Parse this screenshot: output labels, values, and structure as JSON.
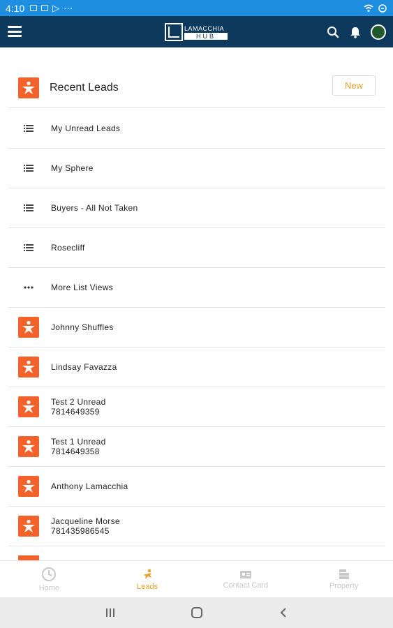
{
  "status_bar": {
    "time": "4:10",
    "more": "···"
  },
  "header": {
    "logo_name": "LAMACCHIA",
    "logo_sub": "HUB"
  },
  "list": {
    "title": "Recent Leads",
    "new_label": "New",
    "list_views": [
      {
        "label": "My Unread Leads",
        "icon": "list-icon"
      },
      {
        "label": "My Sphere",
        "icon": "list-icon"
      },
      {
        "label": "Buyers - All Not Taken",
        "icon": "list-icon"
      },
      {
        "label": "Rosecliff",
        "icon": "list-icon"
      },
      {
        "label": "More List Views",
        "icon": "more-icon"
      }
    ],
    "leads": [
      {
        "name": "Johnny Shuffles",
        "phone": ""
      },
      {
        "name": "Lindsay Favazza",
        "phone": ""
      },
      {
        "name": "Test 2 Unread",
        "phone": "7814649359"
      },
      {
        "name": "Test 1 Unread",
        "phone": "7814649358"
      },
      {
        "name": "Anthony Lamacchia",
        "phone": ""
      },
      {
        "name": "Jacqueline Morse",
        "phone": "781435986545"
      }
    ]
  },
  "bottom_nav": [
    {
      "label": "Home",
      "icon": "clock-icon",
      "active": false
    },
    {
      "label": "Leads",
      "icon": "leads-icon",
      "active": true
    },
    {
      "label": "Contact Card",
      "icon": "contact-card-icon",
      "active": false
    },
    {
      "label": "Property",
      "icon": "property-icon",
      "active": false
    }
  ],
  "colors": {
    "header": "#0d3a5c",
    "status_bar": "#1e8ee0",
    "lead_badge": "#f2622a",
    "accent": "#e5a12a"
  }
}
